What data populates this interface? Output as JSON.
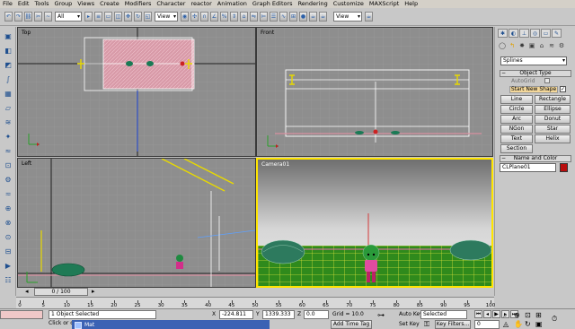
{
  "menu": [
    "File",
    "Edit",
    "Tools",
    "Group",
    "Views",
    "Create",
    "Modifiers",
    "Character",
    "reactor",
    "Animation",
    "Graph Editors",
    "Rendering",
    "Customize",
    "MAXScript",
    "Help"
  ],
  "toolbar": {
    "filter_value": "All",
    "refcoord_value": "View",
    "right_view_value": "View"
  },
  "viewports": {
    "top_label": "Top",
    "front_label": "Front",
    "left_label": "Left",
    "camera_label": "Camera01"
  },
  "command_panel": {
    "category_value": "Splines",
    "object_type_title": "Object Type",
    "autogrid_label": "AutoGrid",
    "start_new_shape_label": "Start New Shape",
    "start_new_shape_checked": "✓",
    "buttons": [
      "Line",
      "Rectangle",
      "Circle",
      "Ellipse",
      "Arc",
      "Donut",
      "NGon",
      "Star",
      "Text",
      "Helix",
      "Section"
    ],
    "name_color_title": "Name and Color",
    "object_name": "CLPlane01",
    "object_color": "#b80d0d"
  },
  "timeline": {
    "frame_display": "0 / 100",
    "ticks": [
      "0",
      "5",
      "10",
      "15",
      "20",
      "25",
      "30",
      "35",
      "40",
      "45",
      "50",
      "55",
      "60",
      "65",
      "70",
      "75",
      "80",
      "85",
      "90",
      "95",
      "100"
    ]
  },
  "status": {
    "selection_info": "1 Object Selected",
    "prompt": "Click or c",
    "taskbar_item": "Mat",
    "x_label": "X",
    "x_value": "-224.811",
    "y_label": "Y",
    "y_value": "1339.333",
    "z_label": "Z",
    "z_value": "0.0",
    "grid_label": "Grid = 10.0",
    "add_time_tag": "Add Time Tag",
    "auto_key": "Auto Key",
    "set_key": "Set Key",
    "selected_value": "Selected",
    "key_filters": "Key Filters...",
    "frame_value": "0"
  }
}
